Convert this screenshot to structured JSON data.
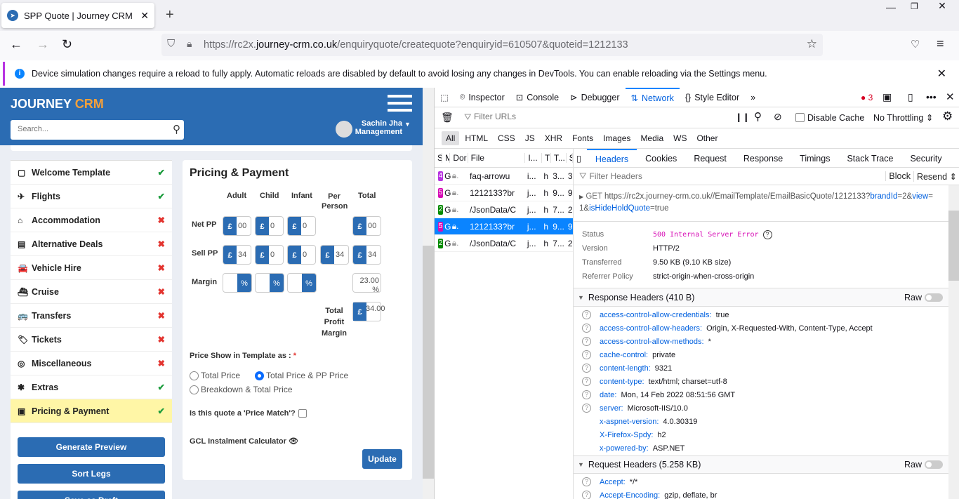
{
  "browser": {
    "tab_title": "SPP Quote | Journey CRM",
    "url_prefix": "https://rc2x.",
    "url_domain": "journey-crm.co.uk",
    "url_path": "/enquiryquote/createquote?enquiryid=610507&quoteid=1212133",
    "notice": "Device simulation changes require a reload to fully apply. Automatic reloads are disabled by default to avoid losing any changes in DevTools. You can enable reloading via the Settings menu."
  },
  "crm": {
    "logo_a": "JOURNEY",
    "logo_b": "CRM",
    "search_placeholder": "Search...",
    "user_name": "Sachin Jha",
    "user_role": "Management",
    "sidebar": [
      {
        "label": "Welcome Template",
        "icon": "▢",
        "status": "ok"
      },
      {
        "label": "Flights",
        "icon": "✈",
        "status": "ok"
      },
      {
        "label": "Accommodation",
        "icon": "⌂",
        "status": "bad"
      },
      {
        "label": "Alternative Deals",
        "icon": "▤",
        "status": "bad"
      },
      {
        "label": "Vehicle Hire",
        "icon": "🚘",
        "status": "bad"
      },
      {
        "label": "Cruise",
        "icon": "⛴",
        "status": "bad"
      },
      {
        "label": "Transfers",
        "icon": "🚌",
        "status": "bad"
      },
      {
        "label": "Tickets",
        "icon": "🏷",
        "status": "bad"
      },
      {
        "label": "Miscellaneous",
        "icon": "◎",
        "status": "bad"
      },
      {
        "label": "Extras",
        "icon": "✱",
        "status": "ok"
      },
      {
        "label": "Pricing & Payment",
        "icon": "▣",
        "status": "ok"
      }
    ],
    "buttons": [
      "Generate Preview",
      "Sort Legs",
      "Save as Draft"
    ],
    "pricing": {
      "title": "Pricing & Payment",
      "cols": [
        "Adult",
        "Child",
        "Infant",
        "Per Person",
        "Total"
      ],
      "rows": {
        "net": "Net PP",
        "sell": "Sell PP",
        "margin": "Margin",
        "tpm": "Total Profit Margin"
      },
      "currency": "£",
      "percent": "%",
      "net_values": [
        "00",
        "0",
        "0",
        "00"
      ],
      "sell_values": [
        "34",
        "0",
        "0",
        "34",
        "34"
      ],
      "margin_total": "23.00 %",
      "total_profit": "34.00",
      "price_show_label": "Price Show in Template as :",
      "required": "*",
      "options": [
        "Total Price",
        "Total Price & PP Price",
        "Breakdown & Total Price"
      ],
      "selected_option": 1,
      "price_match": "Is this quote a 'Price Match'?",
      "gcl": "GCL Instalment Calculator",
      "update": "Update"
    }
  },
  "devtools": {
    "tabs": [
      "Inspector",
      "Console",
      "Debugger",
      "Network",
      "Style Editor"
    ],
    "error_count": "3",
    "filter_placeholder": "Filter URLs",
    "disable_cache": "Disable Cache",
    "throttling": "No Throttling",
    "types": [
      "All",
      "HTML",
      "CSS",
      "JS",
      "XHR",
      "Fonts",
      "Images",
      "Media",
      "WS",
      "Other"
    ],
    "list_cols": [
      "S",
      "M",
      "Dor",
      "File",
      "I...",
      "T",
      "T...",
      "S"
    ],
    "requests": [
      {
        "status": "4",
        "color": "#b833e1",
        "method": "G",
        "file": "faq-arrowu",
        "init": "i...",
        "type": "h",
        "time": "3...",
        "size": "3"
      },
      {
        "status": "5",
        "color": "#d70cb5",
        "method": "G",
        "file": "1212133?br",
        "init": "j...",
        "type": "h",
        "time": "9...",
        "size": "9"
      },
      {
        "status": "2",
        "color": "#058b00",
        "method": "G",
        "file": "/JsonData/C",
        "init": "j...",
        "type": "h",
        "time": "7...",
        "size": "2"
      },
      {
        "status": "5",
        "color": "#d70cb5",
        "method": "G",
        "file": "1212133?br",
        "init": "j...",
        "type": "h",
        "time": "9...",
        "size": "9"
      },
      {
        "status": "2",
        "color": "#058b00",
        "method": "G",
        "file": "/JsonData/C",
        "init": "j...",
        "type": "h",
        "time": "7...",
        "size": "2"
      }
    ],
    "detail_tabs": [
      "Headers",
      "Cookies",
      "Request",
      "Response",
      "Timings",
      "Stack Trace",
      "Security"
    ],
    "filter_headers": "Filter Headers",
    "block": "Block",
    "resend": "Resend",
    "request_line": {
      "method": "GET",
      "url": "https://rc2x.journey-crm.co.uk//EmailTemplate/EmailBasicQuote/1212133",
      "q1": "?",
      "p1": "brandId",
      "v1": "=2",
      "a1": "&",
      "p2": "view",
      "v2": "=",
      "v2b": "1",
      "a2": "&",
      "p3": "isHideHoldQuote",
      "v3": "=true"
    },
    "summary": [
      {
        "k": "Status",
        "v": "500 Internal Server Error"
      },
      {
        "k": "Version",
        "v": "HTTP/2"
      },
      {
        "k": "Transferred",
        "v": "9.50 KB (9.10 KB size)"
      },
      {
        "k": "Referrer Policy",
        "v": "strict-origin-when-cross-origin"
      }
    ],
    "response_title": "Response Headers (410 B)",
    "raw": "Raw",
    "response_headers": [
      {
        "k": "access-control-allow-credentials:",
        "v": "true",
        "q": true
      },
      {
        "k": "access-control-allow-headers:",
        "v": "Origin, X-Requested-With, Content-Type, Accept",
        "q": true
      },
      {
        "k": "access-control-allow-methods:",
        "v": "*",
        "q": true
      },
      {
        "k": "cache-control:",
        "v": "private",
        "q": true
      },
      {
        "k": "content-length:",
        "v": "9321",
        "q": true
      },
      {
        "k": "content-type:",
        "v": "text/html; charset=utf-8",
        "q": true
      },
      {
        "k": "date:",
        "v": "Mon, 14 Feb 2022 08:51:56 GMT",
        "q": true
      },
      {
        "k": "server:",
        "v": "Microsoft-IIS/10.0",
        "q": true
      },
      {
        "k": "x-aspnet-version:",
        "v": "4.0.30319",
        "q": false
      },
      {
        "k": "X-Firefox-Spdy:",
        "v": "h2",
        "q": false
      },
      {
        "k": "x-powered-by:",
        "v": "ASP.NET",
        "q": false
      }
    ],
    "request_title": "Request Headers (5.258 KB)",
    "request_headers": [
      {
        "k": "Accept:",
        "v": "*/*"
      },
      {
        "k": "Accept-Encoding:",
        "v": "gzip, deflate, br"
      }
    ]
  }
}
